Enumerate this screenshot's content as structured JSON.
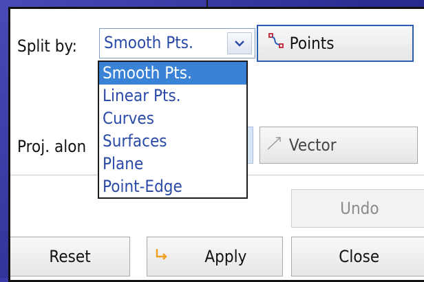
{
  "split_by": {
    "label": "Split by:",
    "selected_value": "Smooth Pts.",
    "dropdown_icon": "chevron-down-icon",
    "options": [
      {
        "label": "Smooth Pts.",
        "selected": true
      },
      {
        "label": "Linear Pts.",
        "selected": false
      },
      {
        "label": "Curves",
        "selected": false
      },
      {
        "label": "Surfaces",
        "selected": false
      },
      {
        "label": "Plane",
        "selected": false
      },
      {
        "label": "Point-Edge",
        "selected": false
      }
    ]
  },
  "points_button": {
    "label": "Points",
    "icon": "points-curve-icon"
  },
  "projection": {
    "label_visible": "Proj. alon",
    "vector_button": {
      "label": "Vector",
      "icon": "vector-arrow-icon"
    }
  },
  "actions": {
    "undo": "Undo",
    "reset": "Reset",
    "apply": "Apply",
    "apply_icon": "apply-arrow-icon",
    "close": "Close"
  },
  "colors": {
    "accent_blue": "#2a5bb5",
    "selection": "#3a82d6",
    "option_text": "#2b4aa8",
    "apply_icon": "#f0a020"
  }
}
